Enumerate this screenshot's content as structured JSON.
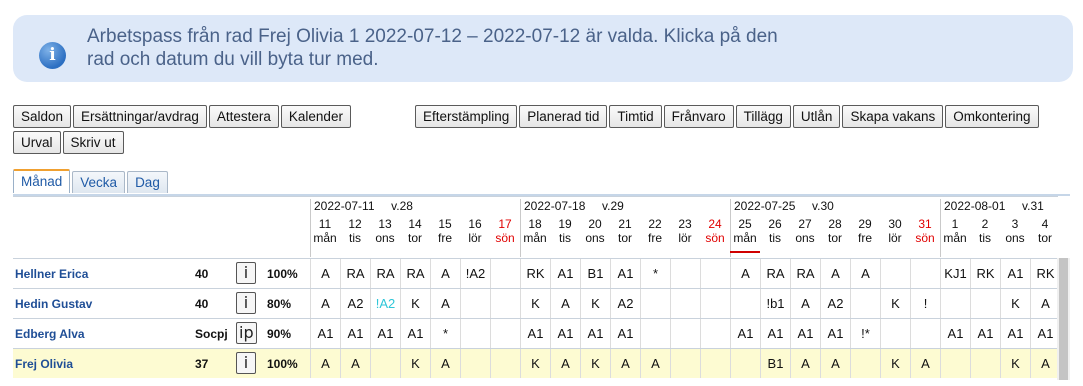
{
  "info": {
    "line1": "Arbetspass från rad Frej Olivia 1 2022-07-12 – 2022-07-12 är valda. Klicka på den",
    "line2": "rad och datum du vill byta tur med.",
    "icon": "info-icon",
    "icon_glyph": "i"
  },
  "toolbar": {
    "left": [
      "Saldon",
      "Ersättningar/avdrag",
      "Attestera",
      "Kalender"
    ],
    "right": [
      "Efterstämpling",
      "Planerad tid",
      "Timtid",
      "Frånvaro",
      "Tillägg",
      "Utlån",
      "Skapa vakans",
      "Omkontering"
    ],
    "row2": [
      "Urval",
      "Skriv ut"
    ]
  },
  "tabs": [
    "Månad",
    "Vecka",
    "Dag"
  ],
  "weeks": [
    {
      "label": "2022-07-11     v.28"
    },
    {
      "label": "2022-07-18     v.29"
    },
    {
      "label": "2022-07-25     v.30"
    },
    {
      "label": "2022-08-01     v.31"
    }
  ],
  "days": [
    {
      "n": "11",
      "d": "mån"
    },
    {
      "n": "12",
      "d": "tis"
    },
    {
      "n": "13",
      "d": "ons"
    },
    {
      "n": "14",
      "d": "tor"
    },
    {
      "n": "15",
      "d": "fre"
    },
    {
      "n": "16",
      "d": "lör"
    },
    {
      "n": "17",
      "d": "sön",
      "sun": true
    },
    {
      "n": "18",
      "d": "mån"
    },
    {
      "n": "19",
      "d": "tis"
    },
    {
      "n": "20",
      "d": "ons"
    },
    {
      "n": "21",
      "d": "tor"
    },
    {
      "n": "22",
      "d": "fre"
    },
    {
      "n": "23",
      "d": "lör"
    },
    {
      "n": "24",
      "d": "sön",
      "sun": true
    },
    {
      "n": "25",
      "d": "mån",
      "today": true
    },
    {
      "n": "26",
      "d": "tis"
    },
    {
      "n": "27",
      "d": "ons"
    },
    {
      "n": "28",
      "d": "tor"
    },
    {
      "n": "29",
      "d": "fre"
    },
    {
      "n": "30",
      "d": "lör"
    },
    {
      "n": "31",
      "d": "sön",
      "sun": true
    },
    {
      "n": "1",
      "d": "mån"
    },
    {
      "n": "2",
      "d": "tis"
    },
    {
      "n": "3",
      "d": "ons"
    },
    {
      "n": "4",
      "d": "tor"
    }
  ],
  "employees": [
    {
      "name": "Hellner Erica",
      "hours": "40",
      "btn": "i",
      "pct": "100%",
      "cells": [
        "A",
        "RA",
        "RA",
        "RA",
        "A",
        "!A2",
        "",
        "RK",
        "A1",
        "B1",
        "A1",
        "*",
        "",
        "",
        "A",
        "RA",
        "RA",
        "A",
        "A",
        "",
        "",
        "KJ1",
        "RK",
        "A1",
        "RK"
      ]
    },
    {
      "name": "Hedin Gustav",
      "hours": "40",
      "btn": "i",
      "pct": "80%",
      "cells": [
        "A",
        "A2",
        "!A2",
        "K",
        "A",
        "",
        "",
        "K",
        "A",
        "K",
        "A2",
        "",
        "",
        "",
        "",
        "!b1",
        "A",
        "A2",
        "",
        "K",
        "!",
        "",
        "",
        "K",
        "A"
      ],
      "cyan": [
        2
      ]
    },
    {
      "name": "Edberg Alva",
      "hours": "Socpj",
      "btn": "ip",
      "pct": "90%",
      "cells": [
        "A1",
        "A1",
        "A1",
        "A1",
        "*",
        "",
        "",
        "A1",
        "A1",
        "A1",
        "A1",
        "",
        "",
        "",
        "A1",
        "A1",
        "A1",
        "A1",
        "!*",
        "",
        "",
        "A1",
        "A1",
        "A1",
        "A1"
      ]
    },
    {
      "name": "Frej Olivia",
      "hours": "37",
      "btn": "i",
      "pct": "100%",
      "selected": true,
      "cells": [
        "A",
        "A",
        "",
        "K",
        "A",
        "",
        "",
        "K",
        "A",
        "K",
        "A",
        "A",
        "",
        "",
        "",
        "B1",
        "A",
        "A",
        "",
        "K",
        "A",
        "",
        "",
        "K",
        "A"
      ]
    }
  ]
}
